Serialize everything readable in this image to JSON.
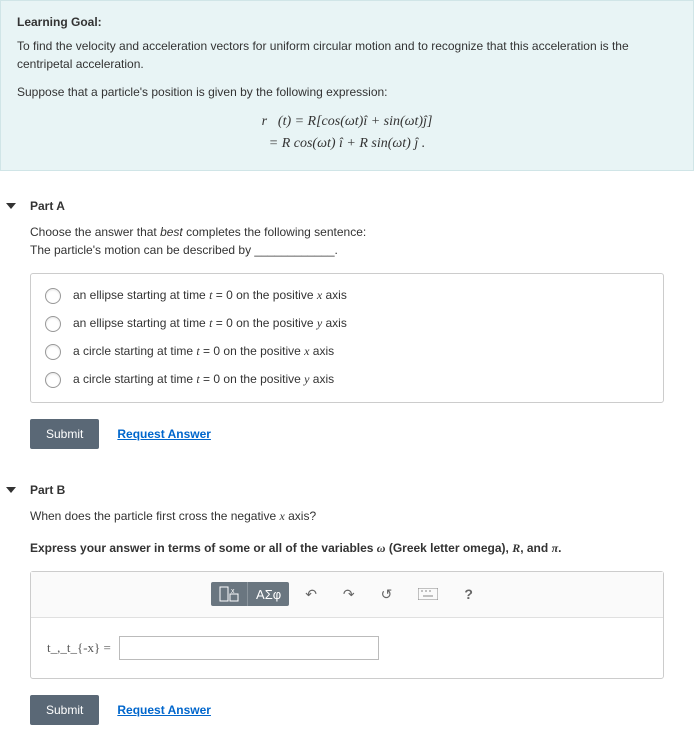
{
  "goal": {
    "title": "Learning Goal:",
    "text": "To find the velocity and acceleration vectors for uniform circular motion and to recognize that this acceleration is the centripetal acceleration.",
    "suppose": "Suppose that a particle's position is given by the following expression:",
    "formula1": "r⃗(t) = R[cos(ωt)î + sin(ωt)ĵ]",
    "formula2": "= R cos(ωt) î + R sin(ωt) ĵ ."
  },
  "partA": {
    "header": "Part A",
    "prompt1": "Choose the answer that ",
    "promptItalic": "best",
    "prompt2": " completes the following sentence:",
    "prompt3": "The particle's motion can be described by ____________.",
    "options": [
      "an ellipse starting at time t = 0 on the positive x axis",
      "an ellipse starting at time t = 0 on the positive y axis",
      "a circle starting at time t = 0 on the positive x axis",
      "a circle starting at time t = 0 on the positive y axis"
    ],
    "submit": "Submit",
    "request": "Request Answer"
  },
  "partB": {
    "header": "Part B",
    "prompt1": "When does the particle first cross the negative ",
    "promptVar": "x",
    "prompt2": " axis?",
    "instruct1": "Express your answer in terms of some or all of the variables ",
    "instructOmega": "ω",
    "instruct2": " (Greek letter omega), ",
    "instructR": "R",
    "instruct3": ", and ",
    "instructPi": "π",
    "instruct4": ".",
    "toolTemplate": "T",
    "toolSigma": "ΑΣφ",
    "label": "t_,_t_{-x} = ",
    "submit": "Submit",
    "request": "Request Answer"
  }
}
